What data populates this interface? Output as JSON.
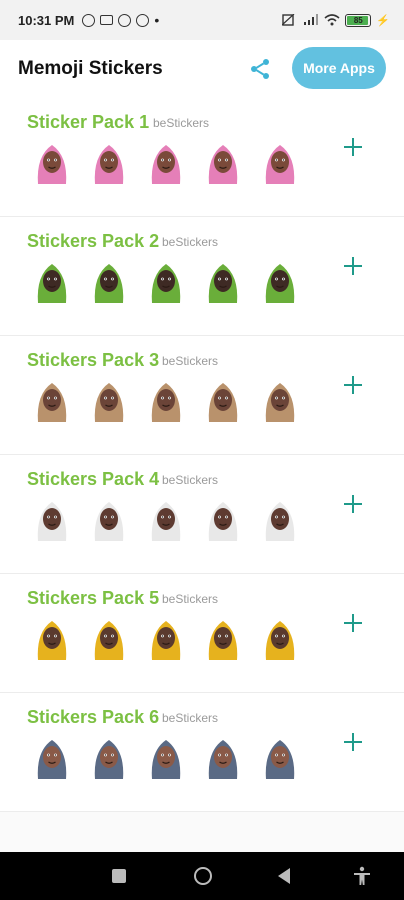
{
  "status_bar": {
    "time": "10:31 PM",
    "battery": "85"
  },
  "app_bar": {
    "title": "Memoji Stickers",
    "more_apps_label": "More Apps"
  },
  "packs": [
    {
      "title": "Sticker Pack 1",
      "author": "beStickers",
      "skin": "#7a4a3a",
      "hijab": "#e57fb8"
    },
    {
      "title": "Stickers Pack 2",
      "author": "beStickers",
      "skin": "#3e2a24",
      "hijab": "#6aae3a"
    },
    {
      "title": "Stickers Pack 3",
      "author": "beStickers",
      "skin": "#6b4438",
      "hijab": "#b9926c"
    },
    {
      "title": "Stickers Pack 4",
      "author": "beStickers",
      "skin": "#5e3b31",
      "hijab": "#e8e8e8"
    },
    {
      "title": "Stickers Pack 5",
      "author": "beStickers",
      "skin": "#5a3a2e",
      "hijab": "#e6b21e"
    },
    {
      "title": "Stickers Pack 6",
      "author": "beStickers",
      "skin": "#8a5a48",
      "hijab": "#5a6a85"
    }
  ],
  "colors": {
    "accent_green": "#7cc043",
    "accent_teal": "#1f9a8a",
    "more_apps_bg": "#62c1e0",
    "share_icon": "#3fb4d6"
  }
}
